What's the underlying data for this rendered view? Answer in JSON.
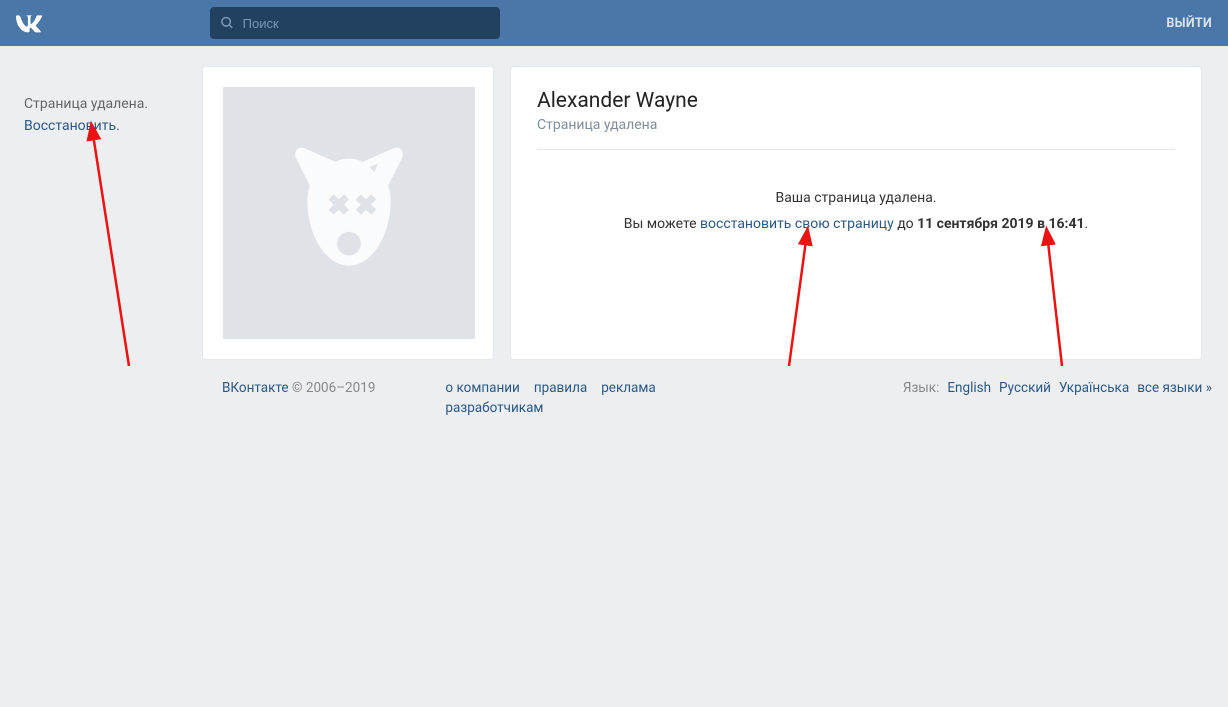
{
  "header": {
    "search_placeholder": "Поиск",
    "logout": "ВЫЙТИ"
  },
  "sidebar": {
    "status": "Страница удалена.",
    "restore": "Восстановить."
  },
  "profile": {
    "name": "Alexander Wayne",
    "subtitle": "Страница удалена",
    "deleted_heading": "Ваша страница удалена.",
    "restore_prefix": "Вы можете ",
    "restore_link": "восстановить свою страницу",
    "restore_middle": " до ",
    "deadline": "11 сентября 2019 в 16:41",
    "restore_suffix": "."
  },
  "footer": {
    "brand": "ВКонтакте",
    "copyright": " © 2006–2019",
    "links": {
      "about": "о компании",
      "rules": "правила",
      "ads": "реклама",
      "devs": "разработчикам"
    },
    "lang_label": "Язык:",
    "langs": {
      "en": "English",
      "ru": "Русский",
      "ua": "Українська",
      "all": "все языки »"
    }
  }
}
